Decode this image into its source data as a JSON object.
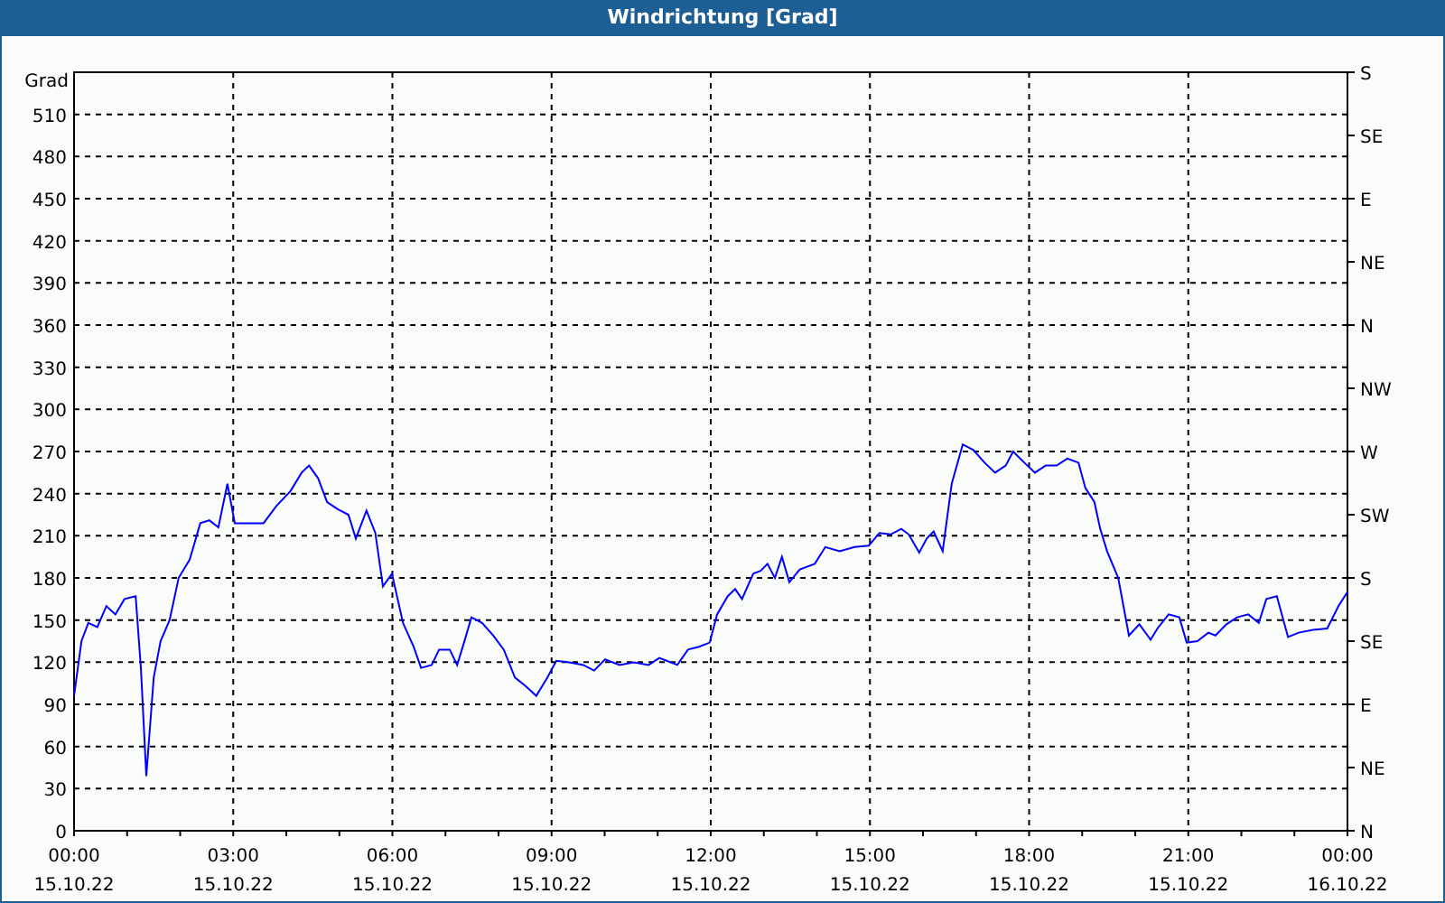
{
  "window": {
    "title": "Windrichtung [Grad]"
  },
  "chart": {
    "xtick_dates": [
      "15.10.22",
      "15.10.22",
      "15.10.22",
      "15.10.22",
      "15.10.22",
      "15.10.22",
      "15.10.22",
      "15.10.22",
      "16.10.22"
    ],
    "right_axis_labels": [
      "S",
      "SE",
      "E",
      "NE",
      "N",
      "NW",
      "W",
      "SW",
      "S",
      "SE",
      "E",
      "NE",
      "N"
    ],
    "chart_data": {
      "type": "line",
      "ylabel": "Grad",
      "x": [
        0,
        0.14,
        0.27,
        0.44,
        0.61,
        0.78,
        0.95,
        1.16,
        1.26,
        1.36,
        1.5,
        1.63,
        1.8,
        1.97,
        2.18,
        2.38,
        2.55,
        2.72,
        2.89,
        3.03,
        3.23,
        3.57,
        3.81,
        4.08,
        4.29,
        4.43,
        4.6,
        4.77,
        4.97,
        5.17,
        5.31,
        5.51,
        5.68,
        5.82,
        5.99,
        6.2,
        6.4,
        6.54,
        6.74,
        6.88,
        7.08,
        7.22,
        7.35,
        7.49,
        7.69,
        7.9,
        8.1,
        8.31,
        8.51,
        8.71,
        8.92,
        9.09,
        9.33,
        9.6,
        9.8,
        10.01,
        10.28,
        10.55,
        10.83,
        11.03,
        11.17,
        11.37,
        11.57,
        11.78,
        11.98,
        12.12,
        12.32,
        12.46,
        12.59,
        12.8,
        12.94,
        13.07,
        13.21,
        13.34,
        13.48,
        13.68,
        13.96,
        14.16,
        14.43,
        14.71,
        14.98,
        15.18,
        15.39,
        15.59,
        15.73,
        15.93,
        16.07,
        16.2,
        16.37,
        16.54,
        16.75,
        16.95,
        17.16,
        17.36,
        17.56,
        17.7,
        17.91,
        18.11,
        18.31,
        18.52,
        18.72,
        18.93,
        19.06,
        19.23,
        19.34,
        19.47,
        19.68,
        19.88,
        20.08,
        20.29,
        20.42,
        20.63,
        20.83,
        20.97,
        21.17,
        21.38,
        21.51,
        21.72,
        21.92,
        22.13,
        22.33,
        22.47,
        22.67,
        22.88,
        23.08,
        23.35,
        23.62,
        23.83,
        24
      ],
      "series": [
        {
          "color": "#0000ff",
          "values": [
            96,
            135,
            148,
            145,
            160,
            154,
            165,
            167,
            116,
            39,
            109,
            135,
            150,
            180,
            193,
            219,
            221,
            216,
            247,
            219,
            219,
            219,
            231,
            242,
            255,
            260,
            251,
            234,
            229,
            225,
            208,
            228,
            212,
            174,
            183,
            148,
            131,
            116,
            118,
            129,
            129,
            118,
            134,
            152,
            148,
            139,
            129,
            109,
            103,
            96,
            109,
            121,
            120,
            118,
            114,
            122,
            118,
            120,
            118,
            123,
            121,
            118,
            129,
            131,
            134,
            154,
            167,
            172,
            165,
            183,
            185,
            190,
            180,
            195,
            177,
            186,
            190,
            202,
            199,
            202,
            203,
            212,
            211,
            215,
            211,
            198,
            208,
            213,
            199,
            247,
            275,
            271,
            262,
            255,
            260,
            270,
            262,
            255,
            260,
            260,
            265,
            262,
            244,
            234,
            215,
            199,
            180,
            139,
            147,
            136,
            144,
            154,
            152,
            134,
            135,
            141,
            139,
            147,
            152,
            154,
            148,
            165,
            167,
            138,
            141,
            143,
            144,
            160,
            170
          ]
        }
      ],
      "xlim": [
        0,
        24
      ],
      "ylim": [
        0,
        540
      ],
      "grid": true,
      "xticks": [
        {
          "value": 0,
          "label": "00:00"
        },
        {
          "value": 3,
          "label": "03:00"
        },
        {
          "value": 6,
          "label": "06:00"
        },
        {
          "value": 9,
          "label": "09:00"
        },
        {
          "value": 12,
          "label": "12:00"
        },
        {
          "value": 15,
          "label": "15:00"
        },
        {
          "value": 18,
          "label": "18:00"
        },
        {
          "value": 21,
          "label": "21:00"
        },
        {
          "value": 24,
          "label": "00:00"
        }
      ],
      "yticks": [
        0,
        30,
        60,
        90,
        120,
        150,
        180,
        210,
        240,
        270,
        300,
        330,
        360,
        390,
        420,
        450,
        480,
        510
      ]
    }
  }
}
